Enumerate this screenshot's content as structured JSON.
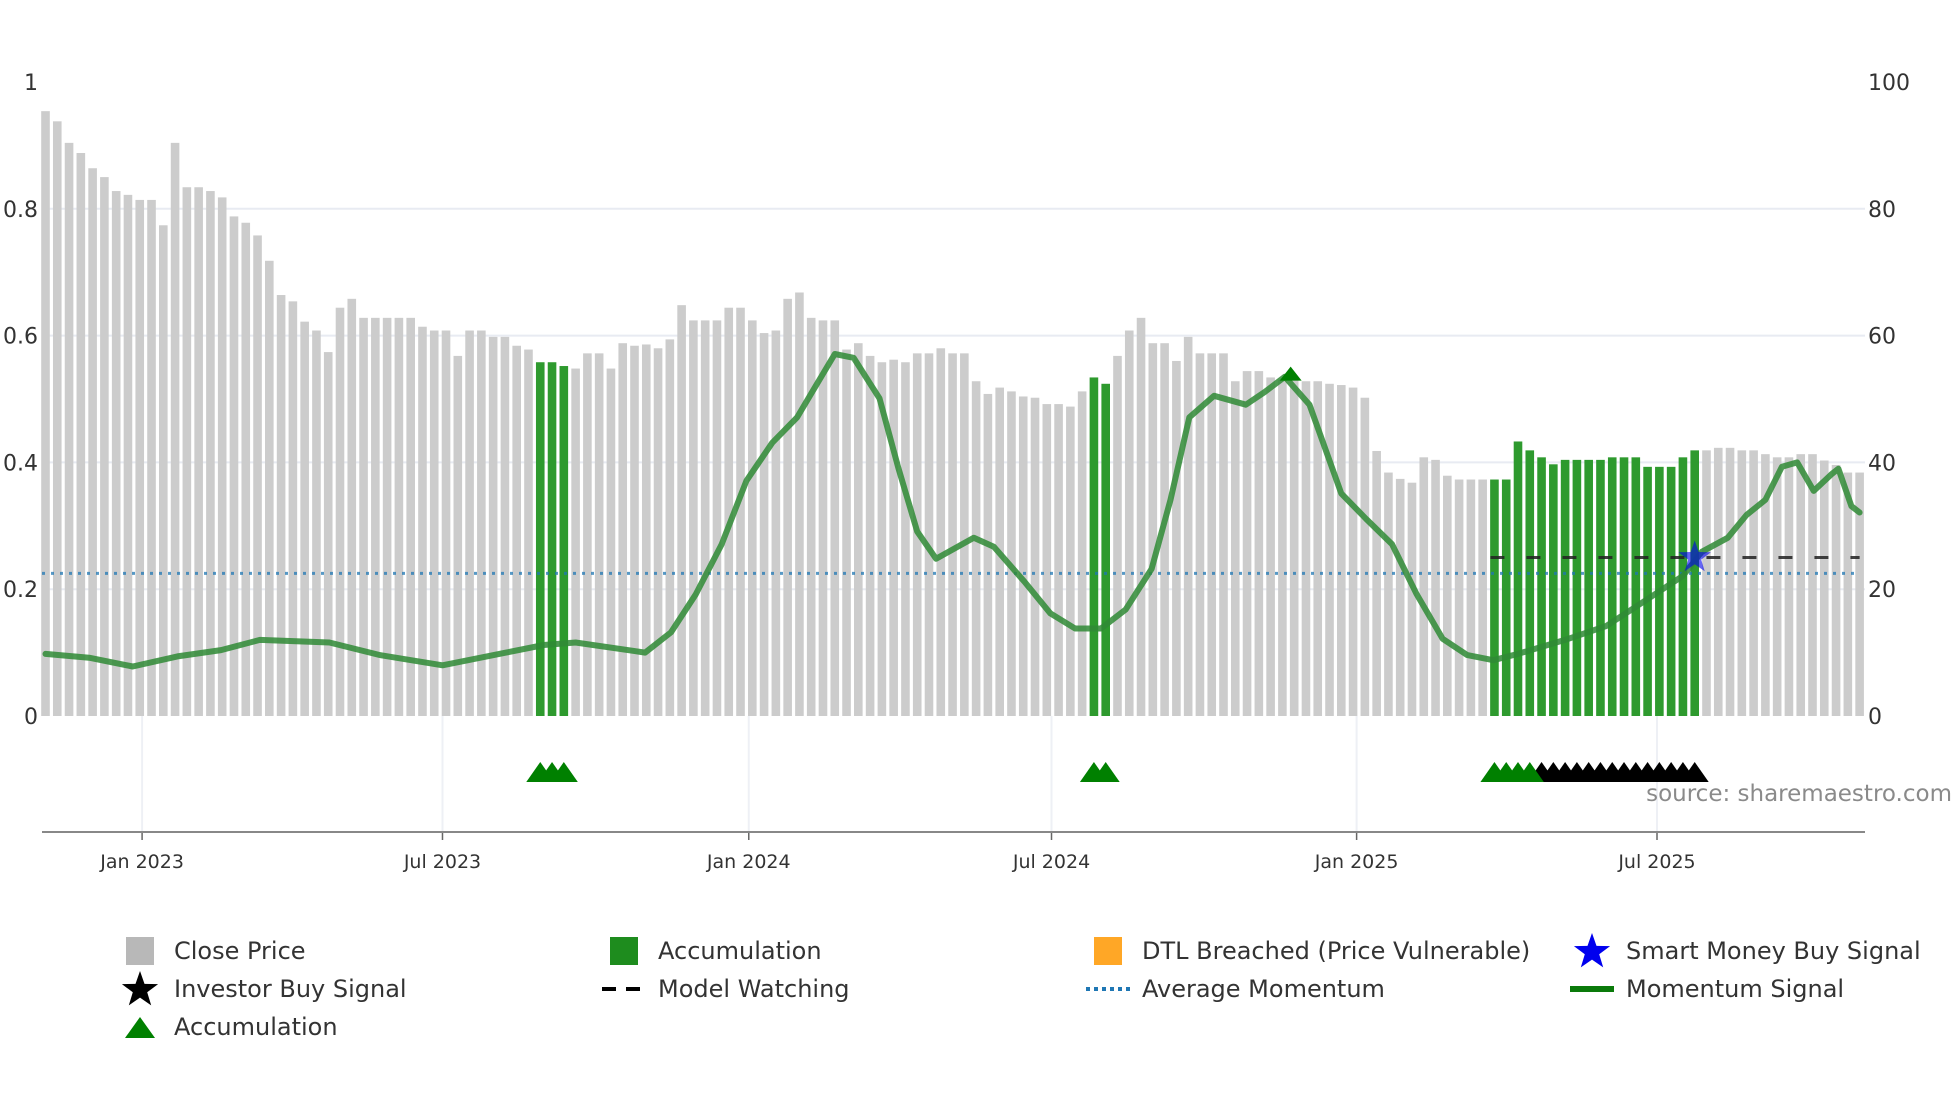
{
  "chart_data": {
    "type": "bar",
    "title": "",
    "x_unit": "week index (weekly bars)",
    "left_axis": {
      "ylim": [
        0,
        1
      ],
      "ticks": [
        "0",
        "0.2",
        "0.4",
        "0.6",
        "0.8",
        "1"
      ],
      "tick_values": [
        0,
        0.2,
        0.4,
        0.6,
        0.8,
        1
      ]
    },
    "right_axis": {
      "ylim": [
        0,
        100
      ],
      "ticks": [
        "0",
        "20",
        "40",
        "60",
        "80",
        "100"
      ],
      "tick_values": [
        0,
        20,
        40,
        60,
        80,
        100
      ]
    },
    "x_ticks": [
      {
        "label": "Jan 2023",
        "x": 8.2
      },
      {
        "label": "Jul 2023",
        "x": 33.7
      },
      {
        "label": "Jan 2024",
        "x": 59.7
      },
      {
        "label": "Jul 2024",
        "x": 85.4
      },
      {
        "label": "Jan 2025",
        "x": 111.3
      },
      {
        "label": "Jul 2025",
        "x": 136.8
      }
    ],
    "close_price": [
      95.4,
      93.8,
      90.4,
      88.8,
      86.4,
      85,
      82.8,
      82.2,
      81.4,
      81.4,
      77.4,
      90.4,
      83.4,
      83.4,
      82.8,
      81.8,
      78.8,
      77.8,
      75.8,
      71.8,
      66.4,
      65.4,
      62.2,
      60.8,
      57.4,
      64.4,
      65.8,
      62.8,
      62.8,
      62.8,
      62.8,
      62.8,
      61.4,
      60.8,
      60.8,
      56.8,
      60.8,
      60.8,
      59.8,
      59.8,
      58.4,
      57.8,
      55.8,
      55.8,
      55.2,
      54.8,
      57.2,
      57.2,
      54.8,
      58.8,
      58.4,
      58.6,
      58,
      59.4,
      64.8,
      62.4,
      62.4,
      62.4,
      64.4,
      64.4,
      62.4,
      60.4,
      60.8,
      65.8,
      66.8,
      62.8,
      62.4,
      62.4,
      57.8,
      58.8,
      56.8,
      55.8,
      56.2,
      55.8,
      57.2,
      57.2,
      58,
      57.2,
      57.2,
      52.8,
      50.8,
      51.8,
      51.2,
      50.4,
      50.2,
      49.2,
      49.2,
      48.8,
      51.2,
      53.4,
      52.4,
      56.8,
      60.8,
      62.8,
      58.8,
      58.8,
      56,
      59.8,
      57.2,
      57.2,
      57.2,
      52.8,
      54.4,
      54.4,
      53.4,
      53,
      53.4,
      52.8,
      52.8,
      52.4,
      52.2,
      51.8,
      50.2,
      41.8,
      38.4,
      37.4,
      36.8,
      40.8,
      40.4,
      37.9,
      37.3,
      37.3,
      37.3,
      37.3,
      37.3,
      43.3,
      41.9,
      40.8,
      39.7,
      40.4,
      40.4,
      40.4,
      40.4,
      40.8,
      40.8,
      40.8,
      39.3,
      39.3,
      39.3,
      40.8,
      41.9,
      41.9,
      42.3,
      42.3,
      41.9,
      41.9,
      41.3,
      40.8,
      40.8,
      41.3,
      41.3,
      40.3,
      39.6,
      38.4,
      38.4
    ],
    "accumulation_bars": [
      42,
      43,
      44,
      89,
      90,
      123,
      124,
      125,
      126,
      127,
      128,
      129,
      130,
      131,
      132,
      133,
      134,
      135,
      136,
      137,
      138,
      139,
      140
    ],
    "momentum_signal": [
      [
        0,
        0.098
      ],
      [
        3.7,
        0.092
      ],
      [
        7.4,
        0.078
      ],
      [
        11.2,
        0.094
      ],
      [
        14.9,
        0.104
      ],
      [
        18.2,
        0.12
      ],
      [
        24.1,
        0.116
      ],
      [
        28.4,
        0.096
      ],
      [
        33.7,
        0.08
      ],
      [
        39.1,
        0.1
      ],
      [
        42.3,
        0.112
      ],
      [
        45,
        0.116
      ],
      [
        50.9,
        0.1
      ],
      [
        53.1,
        0.132
      ],
      [
        55.2,
        0.192
      ],
      [
        57.4,
        0.271
      ],
      [
        59.5,
        0.371
      ],
      [
        61.7,
        0.431
      ],
      [
        63.8,
        0.471
      ],
      [
        65.4,
        0.521
      ],
      [
        67,
        0.571
      ],
      [
        68.6,
        0.565
      ],
      [
        70.8,
        0.501
      ],
      [
        72.4,
        0.391
      ],
      [
        74,
        0.291
      ],
      [
        75.6,
        0.248
      ],
      [
        78.8,
        0.281
      ],
      [
        80.5,
        0.267
      ],
      [
        83.1,
        0.212
      ],
      [
        85.3,
        0.162
      ],
      [
        87.4,
        0.138
      ],
      [
        89.6,
        0.138
      ],
      [
        91.7,
        0.168
      ],
      [
        93.9,
        0.232
      ],
      [
        95.5,
        0.341
      ],
      [
        97.1,
        0.471
      ],
      [
        99.2,
        0.505
      ],
      [
        101.9,
        0.491
      ],
      [
        103.5,
        0.511
      ],
      [
        105.2,
        0.535
      ],
      [
        107.3,
        0.491
      ],
      [
        110,
        0.351
      ],
      [
        112.1,
        0.311
      ],
      [
        114.3,
        0.271
      ],
      [
        116.4,
        0.192
      ],
      [
        118.6,
        0.122
      ],
      [
        120.7,
        0.096
      ],
      [
        122.9,
        0.088
      ],
      [
        125,
        0.098
      ],
      [
        129.3,
        0.122
      ],
      [
        132.5,
        0.142
      ],
      [
        135.8,
        0.182
      ],
      [
        139,
        0.221
      ],
      [
        140.6,
        0.259
      ],
      [
        142.8,
        0.281
      ],
      [
        144.4,
        0.317
      ],
      [
        146,
        0.341
      ],
      [
        147.4,
        0.393
      ],
      [
        148.7,
        0.4
      ],
      [
        150.1,
        0.355
      ],
      [
        151.6,
        0.381
      ],
      [
        152.2,
        0.39
      ],
      [
        153.3,
        0.331
      ],
      [
        154,
        0.321
      ]
    ],
    "average_momentum": 0.225,
    "model_watching": {
      "level": 0.25,
      "from": 123,
      "to": 154
    },
    "smart_money_buy_signals": [
      {
        "x": 140,
        "y": 0.25
      }
    ],
    "accumulation_markers_on_line": [
      {
        "x": 105.7,
        "y": 0.54
      }
    ],
    "accumulation_triangles": [
      42,
      43,
      44,
      89,
      90,
      123,
      124,
      125,
      126
    ],
    "investor_buy_triangles": [
      127,
      128,
      129,
      130,
      131,
      132,
      133,
      134,
      135,
      136,
      137,
      138,
      139,
      140
    ],
    "annotation": "source: sharemaestro.com",
    "legend_placement": "bottom"
  },
  "colors": {
    "close_price": "#cccccc",
    "accumulation_bar": "#2e9a2e",
    "momentum": "#2f8a35",
    "average_momentum": "#1f77b4",
    "dtl": "#ffa726",
    "smart_money": "#0000ee",
    "investor": "#000000",
    "triangle_green": "#008000"
  },
  "legend": [
    {
      "label": "Close Price",
      "icon": "gray-square-icon"
    },
    {
      "label": "Accumulation",
      "icon": "green-square-icon"
    },
    {
      "label": "DTL Breached (Price Vulnerable)",
      "icon": "orange-square-icon"
    },
    {
      "label": "Smart Money Buy Signal",
      "icon": "blue-star-icon"
    },
    {
      "label": "Investor Buy Signal",
      "icon": "black-star-icon"
    },
    {
      "label": "Model Watching",
      "icon": "dashed-line-icon"
    },
    {
      "label": "Average Momentum",
      "icon": "dotted-line-icon"
    },
    {
      "label": "Momentum Signal",
      "icon": "green-line-icon"
    },
    {
      "label": "Accumulation",
      "icon": "green-triangle-icon"
    }
  ]
}
